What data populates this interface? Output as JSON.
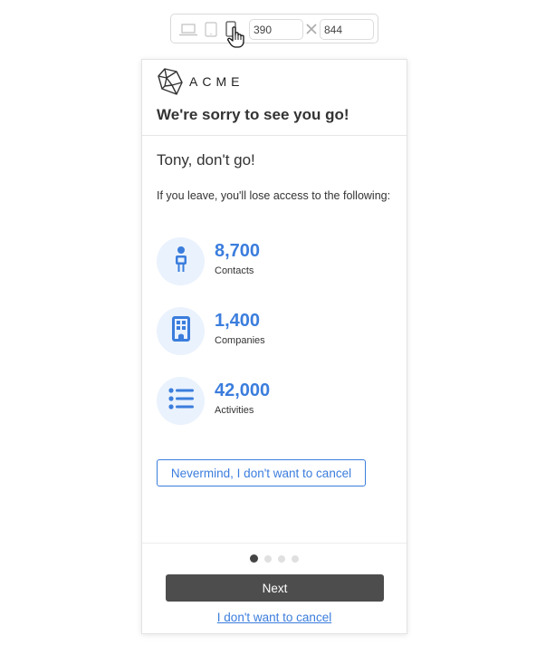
{
  "device_toolbar": {
    "devices": [
      {
        "name": "laptop",
        "icon": "laptop-icon",
        "active": false
      },
      {
        "name": "tablet",
        "icon": "tablet-icon",
        "active": false
      },
      {
        "name": "phone",
        "icon": "phone-icon",
        "active": true
      }
    ],
    "width_value": "390",
    "height_value": "844",
    "separator_icon": "times-icon"
  },
  "header": {
    "brand": "ACME",
    "title": "We're sorry to see you go!"
  },
  "body": {
    "greeting": "Tony, don't go!",
    "lead": "If you leave, you'll lose access to the following:",
    "stats": [
      {
        "icon": "person-icon",
        "value": "8,700",
        "label": "Contacts"
      },
      {
        "icon": "building-icon",
        "value": "1,400",
        "label": "Companies"
      },
      {
        "icon": "list-icon",
        "value": "42,000",
        "label": "Activities"
      }
    ],
    "secondary_button": "Nevermind, I don't want to cancel"
  },
  "footer": {
    "steps_total": 4,
    "step_current": 1,
    "next_button": "Next",
    "cancel_link": "I don't want to cancel"
  },
  "colors": {
    "accent": "#3b7ddd",
    "icon_bg": "#eaf2fd",
    "primary_button": "#4d4d4d"
  }
}
